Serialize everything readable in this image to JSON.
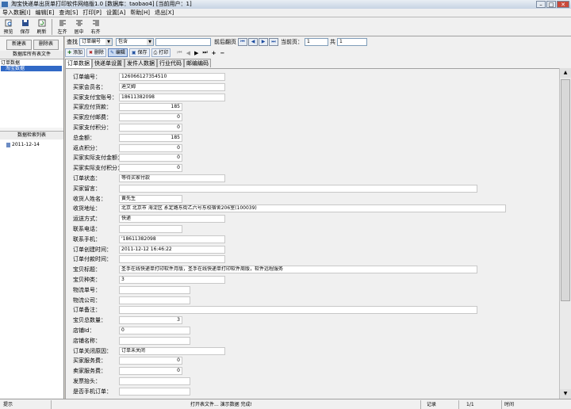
{
  "window": {
    "title": "淘宝快递单出货单打印软件网络版1.0 [数据库：taobao4] [当前用户：1]"
  },
  "menu": [
    "导入数据[I]",
    "编辑[E]",
    "查询[S]",
    "打印[P]",
    "设置[A]",
    "帮助[H]",
    "退出[X]"
  ],
  "toolbar": [
    {
      "label": "预览",
      "icon": "preview-icon"
    },
    {
      "label": "保存",
      "icon": "save-icon"
    },
    {
      "label": "刷新",
      "icon": "refresh-icon"
    },
    {
      "label": "左齐",
      "icon": "align-left-icon"
    },
    {
      "label": "居中",
      "icon": "align-center-icon"
    },
    {
      "label": "右齐",
      "icon": "align-right-icon"
    }
  ],
  "left": {
    "new_table": "新建表",
    "delete_table": "删除表",
    "db_all_files": "数据库所有表文件",
    "tree_parent": "订单数据",
    "tree_child": "淘宝数据",
    "index_list": "数据检索列表",
    "index_date": "2011-12-14"
  },
  "search": {
    "find_label": "查找",
    "field": "订单编号",
    "mode": "包含",
    "keyword": "",
    "nav_label": "前后翻页",
    "current_page_label": "当前页：",
    "current_page": "1",
    "total_label": "共",
    "total": "1"
  },
  "actions": {
    "add": "添加",
    "delete": "删除",
    "edit": "编辑",
    "save": "保存",
    "print": "打印"
  },
  "record_nav": [
    "⏮",
    "◀",
    "▶",
    "⏭",
    "+",
    "−"
  ],
  "tabs": [
    "订单数据",
    "快递单设置",
    "发件人数据",
    "行业代码",
    "邮编编码"
  ],
  "fields": [
    {
      "label": "订单编号：",
      "value": "126066127354510"
    },
    {
      "label": "买家会员名：",
      "value": "迪艾姆"
    },
    {
      "label": "买家支付宝账号：",
      "value": "18611382098"
    },
    {
      "label": "买家应付货款：",
      "value": "185"
    },
    {
      "label": "买家应付邮费：",
      "value": "0"
    },
    {
      "label": "买家支付积分：",
      "value": "0"
    },
    {
      "label": "总金额：",
      "value": "185"
    },
    {
      "label": "返点积分：",
      "value": "0"
    },
    {
      "label": "买家实际支付金额：",
      "value": "0"
    },
    {
      "label": "买家实际支付积分：",
      "value": "0"
    },
    {
      "label": "订单状态：",
      "value": "等待买家付款"
    },
    {
      "label": "买家留言：",
      "value": ""
    },
    {
      "label": "收货人姓名：",
      "value": "黄先生"
    },
    {
      "label": "收货地址：",
      "value": "北京 北京市 海淀区 永定路东街乙六号东校宿舍206室(100039)"
    },
    {
      "label": "运送方式：",
      "value": "快递"
    },
    {
      "label": "联系电话：",
      "value": ""
    },
    {
      "label": "联系手机：",
      "value": "'18611382098"
    },
    {
      "label": "订单创建时间：",
      "value": "2011-12-12 16:46:22"
    },
    {
      "label": "订单付款时间：",
      "value": ""
    },
    {
      "label": "宝贝标题：",
      "value": "圣手在线快递单打印软件月版，圣手在线快递单打印软件周版，软件远程服务"
    },
    {
      "label": "宝贝种类：",
      "value": "3"
    },
    {
      "label": "物流单号：",
      "value": ""
    },
    {
      "label": "物流公司：",
      "value": ""
    },
    {
      "label": "订单备注：",
      "value": ""
    },
    {
      "label": "宝贝总数量：",
      "value": "3"
    },
    {
      "label": "店铺Id：",
      "value": "0"
    },
    {
      "label": "店铺名称：",
      "value": ""
    },
    {
      "label": "订单关闭原因：",
      "value": "订单未关闭"
    },
    {
      "label": "买家服务费：",
      "value": "0"
    },
    {
      "label": "卖家服务费：",
      "value": "0"
    },
    {
      "label": "发票抬头：",
      "value": ""
    },
    {
      "label": "是否手机订单：",
      "value": ""
    }
  ],
  "status": {
    "hint": "提示",
    "message": "打开表文件... 演示数据 完成!",
    "record_label": "记录",
    "record": "1/1",
    "time_label": "时间"
  }
}
